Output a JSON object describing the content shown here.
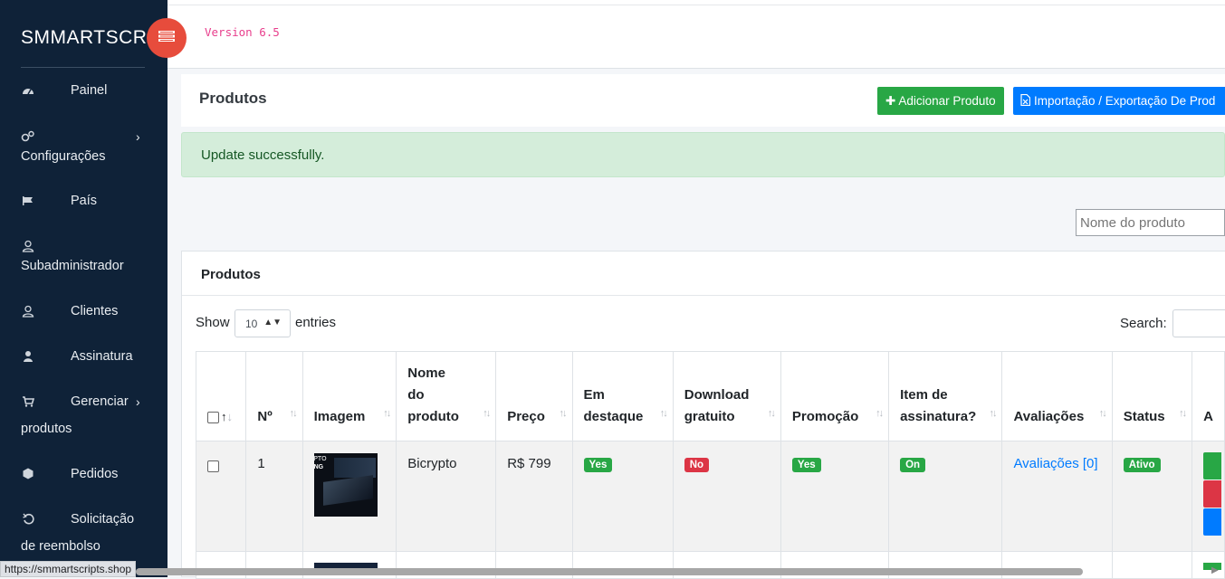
{
  "sidebar": {
    "brand": "SMMARTSCRI",
    "items": [
      {
        "label": "Painel",
        "icon": "dashboard-icon"
      },
      {
        "label": "Configurações",
        "icon": "cogs-icon"
      },
      {
        "label": "País",
        "icon": "flag-icon"
      },
      {
        "label": "Subadministrador",
        "icon": "user-outline-icon"
      },
      {
        "label": "Clientes",
        "icon": "user-outline-icon"
      },
      {
        "label": "Assinatura",
        "icon": "user-icon"
      },
      {
        "label": "Gerenciar",
        "label2": "produtos",
        "icon": "cart-icon"
      },
      {
        "label": "Pedidos",
        "icon": "cube-icon"
      },
      {
        "label": "Solicitação",
        "label2": "de reembolso",
        "icon": "undo-icon"
      }
    ]
  },
  "topbar": {
    "version": "Version 6.5"
  },
  "header": {
    "title": "Produtos",
    "add_button": "Adicionar Produto",
    "import_button": "Importação / Exportação De Prod"
  },
  "alert": {
    "message": "Update successfully."
  },
  "filter": {
    "product_name_placeholder": "Nome do produto"
  },
  "card": {
    "title": "Produtos",
    "show_label": "Show",
    "entries_value": "10",
    "entries_label": "entries",
    "search_label": "Search:"
  },
  "table": {
    "headers": {
      "num": "Nº",
      "image": "Imagem",
      "name": [
        "Nome",
        "do",
        "produto"
      ],
      "price": "Preço",
      "featured": [
        "Em",
        "destaque"
      ],
      "free_download": [
        "Download",
        "gratuito"
      ],
      "promotion": "Promoção",
      "subscription_item": [
        "Item de",
        "assinatura?"
      ],
      "reviews": "Avaliações",
      "status": "Status",
      "actions": "A"
    },
    "rows": [
      {
        "num": "1",
        "thumb_text_1": "PTO",
        "thumb_text_2": "NG",
        "name": "Bicrypto",
        "price": "R$ 799",
        "featured": "Yes",
        "free_download": "No",
        "promotion": "Yes",
        "subscription_item": "On",
        "reviews": "Avaliações [0]",
        "status": "Ativo"
      }
    ]
  },
  "statusbar": {
    "url": "https://smmartscripts.shop"
  },
  "colors": {
    "sidebar_bg": "#0f2238",
    "toggle_red": "#e74c3c",
    "success_green": "#28a745",
    "primary_blue": "#007bff",
    "danger_red": "#dc3545",
    "alert_bg": "#d4edda"
  }
}
